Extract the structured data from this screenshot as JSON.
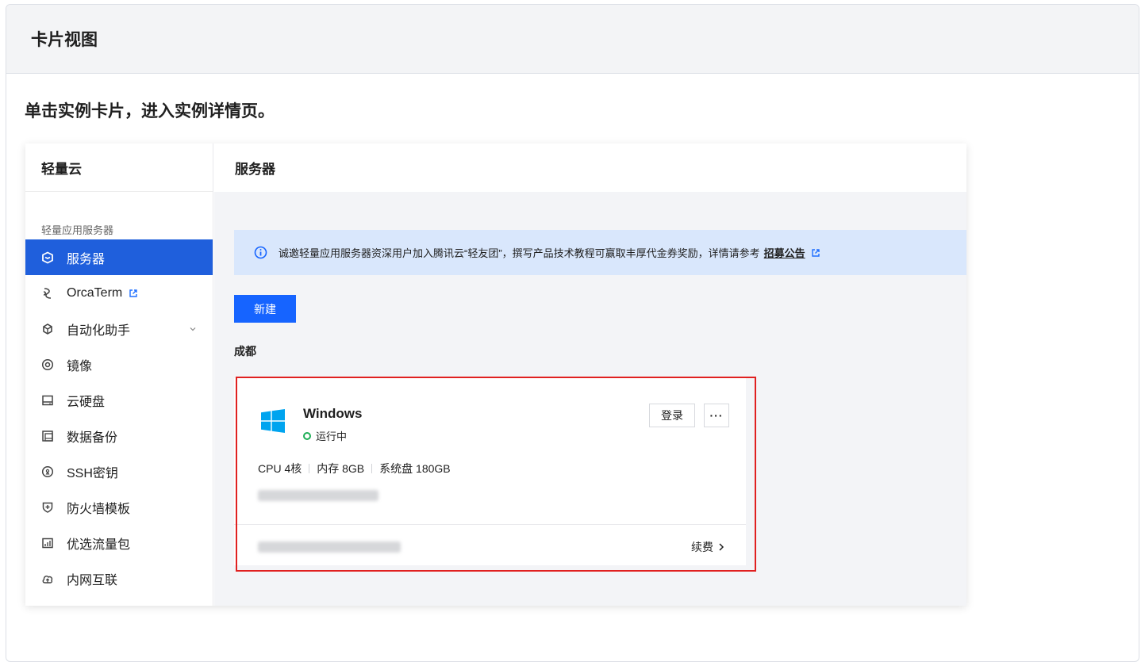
{
  "page": {
    "title": "卡片视图",
    "instruction": "单击实例卡片，进入实例详情页。"
  },
  "sidebar": {
    "header": "轻量云",
    "group_label": "轻量应用服务器",
    "items": [
      {
        "label": "服务器",
        "icon": "server-icon",
        "active": true
      },
      {
        "label": "OrcaTerm",
        "icon": "orcaterm-icon",
        "external": true
      },
      {
        "label": "自动化助手",
        "icon": "automation-icon",
        "expandable": true
      },
      {
        "label": "镜像",
        "icon": "image-icon"
      },
      {
        "label": "云硬盘",
        "icon": "disk-icon"
      },
      {
        "label": "数据备份",
        "icon": "backup-icon"
      },
      {
        "label": "SSH密钥",
        "icon": "key-icon"
      },
      {
        "label": "防火墙模板",
        "icon": "firewall-icon"
      },
      {
        "label": "优选流量包",
        "icon": "traffic-icon"
      },
      {
        "label": "内网互联",
        "icon": "network-icon"
      }
    ]
  },
  "main": {
    "header": "服务器",
    "notice": {
      "text": "诚邀轻量应用服务器资深用户加入腾讯云“轻友团”，撰写产品技术教程可赢取丰厚代金券奖励，详情请参考",
      "link": "招募公告"
    },
    "new_button": "新建",
    "region": "成都",
    "card": {
      "name": "Windows",
      "status": "运行中",
      "login_button": "登录",
      "more_button": "···",
      "specs": [
        "CPU 4核",
        "内存 8GB",
        "系统盘 180GB"
      ],
      "renew": "续费"
    }
  },
  "colors": {
    "accent": "#1664ff",
    "active_nav": "#1f5fdc",
    "status_running": "#1fae57",
    "highlight": "#e02020",
    "notice_bg": "#d9e7fc"
  }
}
